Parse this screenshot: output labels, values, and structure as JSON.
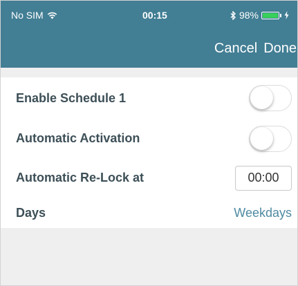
{
  "status_bar": {
    "carrier": "No SIM",
    "time": "00:15",
    "battery_percent": "98%",
    "wifi_icon": "wifi-icon",
    "bluetooth_icon": "bluetooth-icon",
    "battery_icon": "battery-icon",
    "battery_level": 0.98
  },
  "nav": {
    "cancel_label": "Cancel",
    "done_label": "Done",
    "bar_color": "#427e94"
  },
  "settings": {
    "enable_schedule": {
      "label": "Enable Schedule 1",
      "on": false
    },
    "auto_activation": {
      "label": "Automatic Activation",
      "on": false
    },
    "auto_relock": {
      "label": "Automatic Re-Lock at",
      "value": "00:00"
    },
    "days": {
      "label": "Days",
      "value": "Weekdays"
    }
  }
}
